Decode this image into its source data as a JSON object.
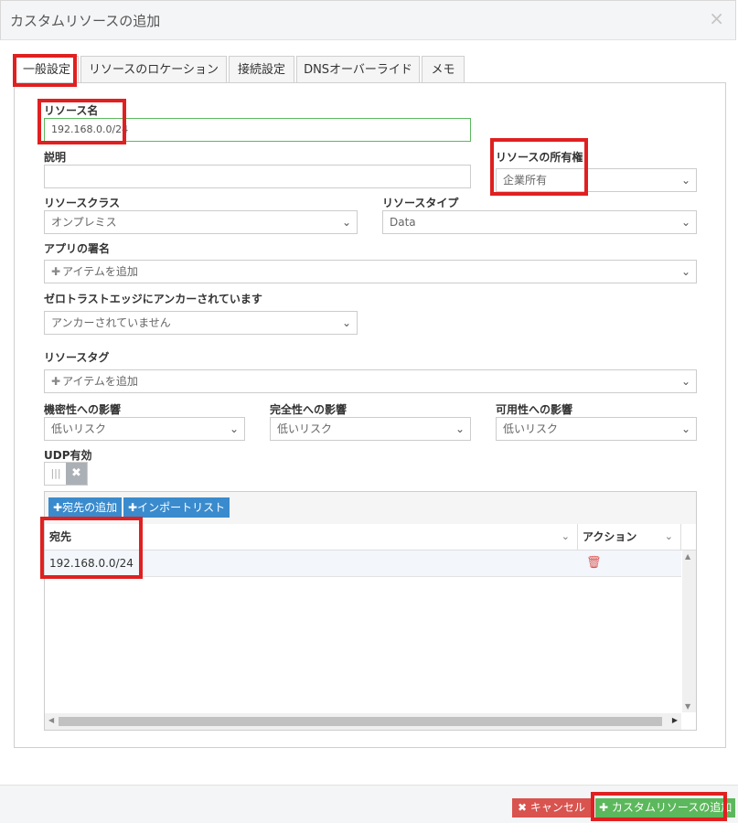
{
  "dialog": {
    "title": "カスタムリソースの追加",
    "close_glyph": "×"
  },
  "tabs": [
    {
      "label": "一般設定"
    },
    {
      "label": "リソースのロケーション"
    },
    {
      "label": "接続設定"
    },
    {
      "label": "DNSオーバーライド"
    },
    {
      "label": "メモ"
    }
  ],
  "form": {
    "resource_name": {
      "label": "リソース名",
      "value": "192.168.0.0/24"
    },
    "description": {
      "label": "説明",
      "value": ""
    },
    "ownership": {
      "label": "リソースの所有権",
      "value": "企業所有"
    },
    "resource_class": {
      "label": "リソースクラス",
      "value": "オンプレミス"
    },
    "resource_type": {
      "label": "リソースタイプ",
      "value": "Data"
    },
    "app_signature": {
      "label": "アプリの署名",
      "placeholder": "アイテムを追加"
    },
    "zero_trust_edge": {
      "label": "ゼロトラストエッジにアンカーされています",
      "value": "アンカーされていません"
    },
    "resource_tags": {
      "label": "リソースタグ",
      "placeholder": "アイテムを追加"
    },
    "confidentiality": {
      "label": "機密性への影響",
      "value": "低いリスク"
    },
    "integrity": {
      "label": "完全性への影響",
      "value": "低いリスク"
    },
    "availability": {
      "label": "可用性への影響",
      "value": "低いリスク"
    },
    "udp": {
      "label": "UDP有効",
      "enabled": false
    }
  },
  "destinations": {
    "add_button": "宛先の追加",
    "import_button": "インポートリスト",
    "columns": [
      "宛先",
      "アクション"
    ],
    "rows": [
      {
        "destination": "192.168.0.0/24"
      }
    ]
  },
  "footer": {
    "cancel_label": "キャンセル",
    "add_label": "カスタムリソースの追加"
  },
  "colors": {
    "highlight": "#e02020",
    "primary": "#3a8bcd",
    "danger": "#d9534f",
    "success": "#5cb85c"
  }
}
